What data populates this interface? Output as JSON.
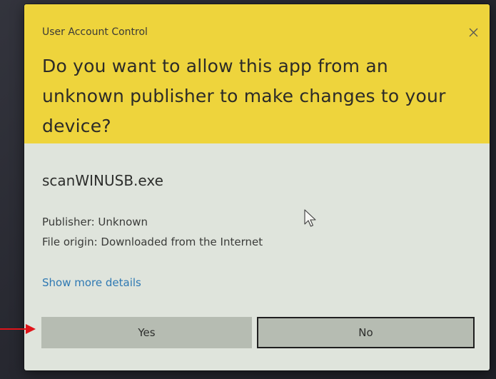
{
  "dialog": {
    "title": "User Account Control",
    "question": "Do you want to allow this app from an unknown publisher to make changes to your device?",
    "app_name": "scanWINUSB.exe",
    "publisher": "Publisher: Unknown",
    "file_origin": "File origin: Downloaded from the Internet",
    "more_details": "Show more details",
    "yes_label": "Yes",
    "no_label": "No",
    "close_icon": "close-icon"
  },
  "colors": {
    "header": "#eed43c",
    "body": "#dfe4dc",
    "link": "#2f79b3",
    "button": "#b6bcb2",
    "annotation_arrow": "#e0141a"
  },
  "annotation": {
    "icon": "red-arrow-icon",
    "points_to": "Yes"
  }
}
